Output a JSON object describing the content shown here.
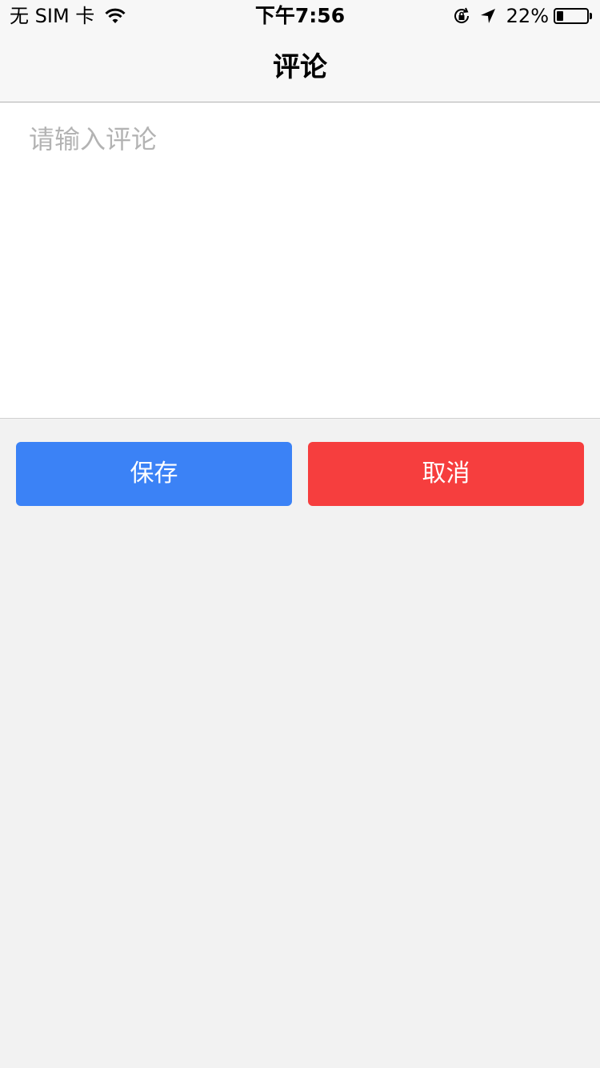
{
  "status_bar": {
    "carrier": "无 SIM 卡",
    "time": "下午7:56",
    "battery_percent": "22%",
    "battery_level": 0.22,
    "icons": [
      "wifi-icon",
      "rotation-lock-icon",
      "location-arrow-icon",
      "battery-icon"
    ]
  },
  "nav": {
    "title": "评论"
  },
  "comment": {
    "placeholder": "请输入评论",
    "value": ""
  },
  "actions": {
    "save_label": "保存",
    "cancel_label": "取消"
  },
  "colors": {
    "save": "#3b82f6",
    "cancel": "#f63e3e",
    "background": "#f2f2f2"
  }
}
